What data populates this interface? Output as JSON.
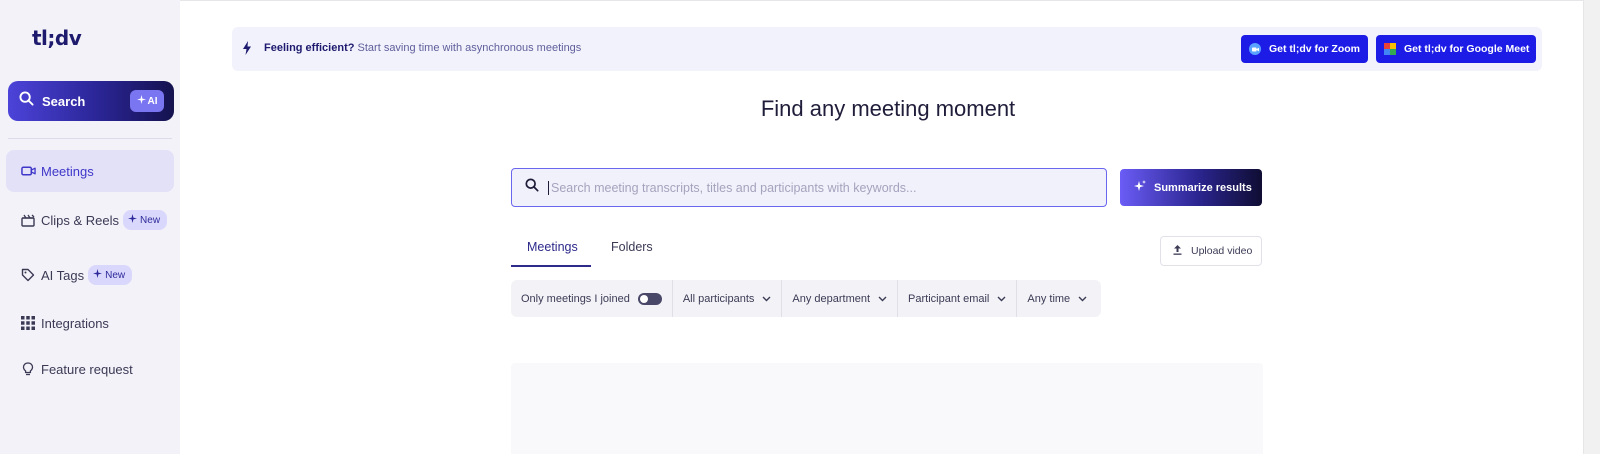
{
  "sidebar": {
    "logo": "tl;dv",
    "search": {
      "label": "Search",
      "ai_badge": "AI"
    },
    "items": [
      {
        "label": "Meetings",
        "icon": "video-camera-icon",
        "active": true
      },
      {
        "label": "Clips & Reels",
        "icon": "clapperboard-icon",
        "badge": "New"
      },
      {
        "label": "AI Tags",
        "icon": "tag-icon",
        "badge": "New"
      },
      {
        "label": "Integrations",
        "icon": "grid-icon"
      },
      {
        "label": "Feature request",
        "icon": "lightbulb-icon"
      }
    ]
  },
  "banner": {
    "bold_text": "Feeling efficient?",
    "text": "Start saving time with asynchronous meetings",
    "zoom_button": "Get tl;dv for Zoom",
    "meet_button": "Get tl;dv for Google Meet"
  },
  "main": {
    "title": "Find any meeting moment",
    "search_placeholder": "Search meeting transcripts, titles and participants with keywords...",
    "summarize_button": "Summarize results",
    "tabs": [
      {
        "label": "Meetings",
        "active": true
      },
      {
        "label": "Folders",
        "active": false
      }
    ],
    "upload_button": "Upload video",
    "filters": {
      "only_joined": "Only meetings I joined",
      "participants": "All participants",
      "department": "Any department",
      "email": "Participant email",
      "time": "Any time"
    }
  },
  "colors": {
    "accent": "#1d1ce6",
    "brand_dark": "#1e1b6e",
    "sidebar_bg": "#f3f2f8"
  }
}
